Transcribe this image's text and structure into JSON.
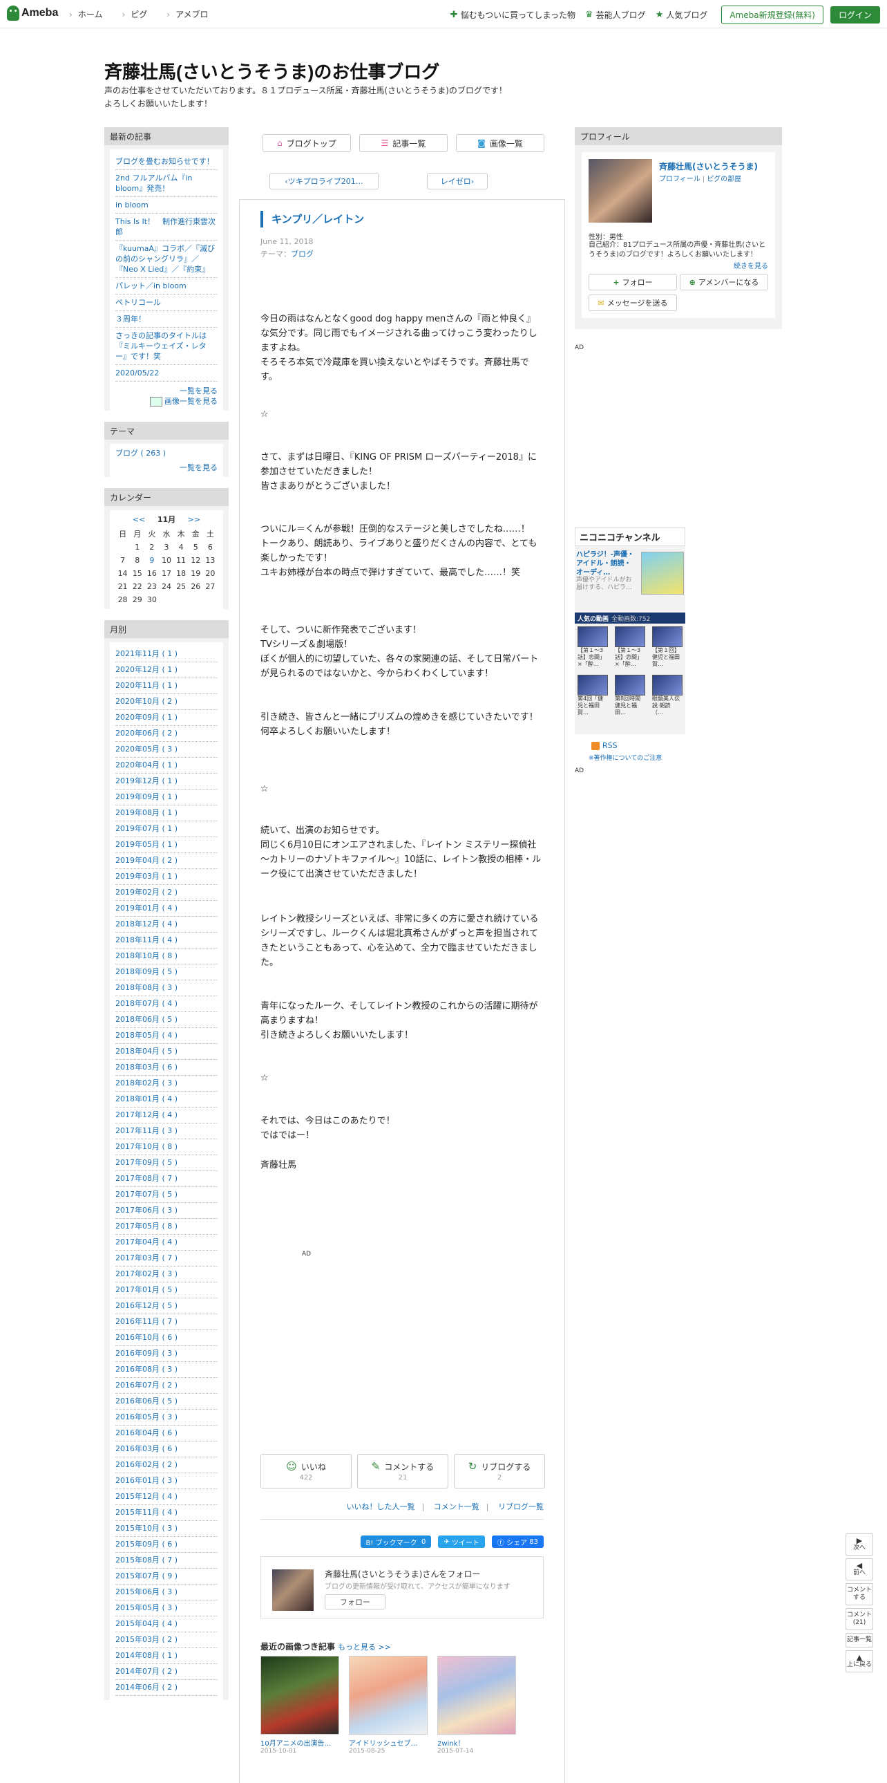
{
  "topbar": {
    "logo": "Ameba",
    "nav": [
      "ホーム",
      "ピグ",
      "アメブロ"
    ],
    "right_links": [
      {
        "icon": "green-star-icon",
        "label": "悩むもついに買ってしまった物"
      },
      {
        "icon": "crown-icon",
        "label": "芸能人ブログ"
      },
      {
        "icon": "star-icon",
        "label": "人気ブログ"
      }
    ],
    "register": "Ameba新規登録(無料)",
    "login": "ログイン"
  },
  "header": {
    "title": "斉藤壮馬(さいとうそうま)のお仕事ブログ",
    "desc1": "声のお仕事をさせていただいております。８１プロデュース所属・斉藤壮馬(さいとうそうま)のブログです！",
    "desc2": "よろしくお願いいたします！"
  },
  "latest": {
    "heading": "最新の記事",
    "items": [
      "ブログを畳むお知らせです！",
      "2nd フルアルバム『in bloom』発売！",
      "in bloom",
      "This Is It！　制作進行東雲次郎",
      "『kuumaA』コラボ／『滅びの前のシャングリラ』／『Neo X Lied』／『約束』",
      "パレット／in bloom",
      "ペトリコール",
      "３周年！",
      "さっきの記事のタイトルは『ミルキーウェイズ・レター』です！笑",
      "2020/05/22"
    ],
    "more": "一覧を見る",
    "img_more": "画像一覧を見る"
  },
  "theme": {
    "heading": "テーマ",
    "item": "ブログ ( 263 )",
    "more": "一覧を見る"
  },
  "calendar": {
    "heading": "カレンダー",
    "prev": "<<",
    "month": "11月",
    "next": ">>",
    "weekdays": [
      "日",
      "月",
      "火",
      "水",
      "木",
      "金",
      "土"
    ],
    "days": [
      "",
      "1",
      "2",
      "3",
      "4",
      "5",
      "6",
      "7",
      "8",
      "9",
      "10",
      "11",
      "12",
      "13",
      "14",
      "15",
      "16",
      "17",
      "18",
      "19",
      "20",
      "21",
      "22",
      "23",
      "24",
      "25",
      "26",
      "27",
      "28",
      "29",
      "30",
      "",
      "",
      "",
      ""
    ],
    "highlight": "9"
  },
  "monthly": {
    "heading": "月別",
    "items": [
      "2021年11月 ( 1 )",
      "2020年12月 ( 1 )",
      "2020年11月 ( 1 )",
      "2020年10月 ( 2 )",
      "2020年09月 ( 1 )",
      "2020年06月 ( 2 )",
      "2020年05月 ( 3 )",
      "2020年04月 ( 1 )",
      "2019年12月 ( 1 )",
      "2019年09月 ( 1 )",
      "2019年08月 ( 1 )",
      "2019年07月 ( 1 )",
      "2019年05月 ( 1 )",
      "2019年04月 ( 2 )",
      "2019年03月 ( 1 )",
      "2019年02月 ( 2 )",
      "2019年01月 ( 4 )",
      "2018年12月 ( 4 )",
      "2018年11月 ( 4 )",
      "2018年10月 ( 8 )",
      "2018年09月 ( 5 )",
      "2018年08月 ( 3 )",
      "2018年07月 ( 4 )",
      "2018年06月 ( 5 )",
      "2018年05月 ( 4 )",
      "2018年04月 ( 5 )",
      "2018年03月 ( 6 )",
      "2018年02月 ( 3 )",
      "2018年01月 ( 4 )",
      "2017年12月 ( 4 )",
      "2017年11月 ( 3 )",
      "2017年10月 ( 8 )",
      "2017年09月 ( 5 )",
      "2017年08月 ( 7 )",
      "2017年07月 ( 5 )",
      "2017年06月 ( 3 )",
      "2017年05月 ( 8 )",
      "2017年04月 ( 4 )",
      "2017年03月 ( 7 )",
      "2017年02月 ( 3 )",
      "2017年01月 ( 5 )",
      "2016年12月 ( 5 )",
      "2016年11月 ( 7 )",
      "2016年10月 ( 6 )",
      "2016年09月 ( 3 )",
      "2016年08月 ( 3 )",
      "2016年07月 ( 2 )",
      "2016年06月 ( 5 )",
      "2016年05月 ( 3 )",
      "2016年04月 ( 6 )",
      "2016年03月 ( 6 )",
      "2016年02月 ( 2 )",
      "2016年01月 ( 3 )",
      "2015年12月 ( 4 )",
      "2015年11月 ( 4 )",
      "2015年10月 ( 3 )",
      "2015年09月 ( 6 )",
      "2015年08月 ( 7 )",
      "2015年07月 ( 9 )",
      "2015年06月 ( 3 )",
      "2015年05月 ( 3 )",
      "2015年04月 ( 4 )",
      "2015年03月 ( 2 )",
      "2014年08月 ( 1 )",
      "2014年07月 ( 2 )",
      "2014年06月 ( 2 )"
    ]
  },
  "main_nav": {
    "top": "ブログトップ",
    "list": "記事一覧",
    "images": "画像一覧"
  },
  "pager": {
    "prev": "ツキプロライブ201…",
    "next": "レイゼロ"
  },
  "article": {
    "title": "キンプリ／レイトン",
    "date": "June 11, 2018",
    "theme_label": "テーマ：",
    "theme": "ブログ",
    "paragraphs": [
      "今日の雨はなんとなくgood dog happy menさんの『雨と仲良く』な気分です。同じ雨でもイメージされる曲ってけっこう変わったりしますよね。\nそろそろ本気で冷蔵庫を買い換えないとやばそうです。斉藤壮馬です。",
      "☆",
      "さて、まずは日曜日、『KING OF PRISM ローズパーティー2018』に参加させていただきました！\n皆さまありがとうございました！",
      "ついにル＝くんが参戦！圧倒的なステージと美しさでしたね……！\nトークあり、朗読あり、ライブありと盛りだくさんの内容で、とても楽しかったです！\nユキお姉様が台本の時点で弾けすぎていて、最高でした……！笑",
      "そして、ついに新作発表でございます！\nTVシリーズ＆劇場版！\nぼくが個人的に切望していた、各々の家関連の話、そして日常パートが見られるのではないかと、今からわくわくしています！",
      "引き続き、皆さんと一緒にプリズムの煌めきを感じていきたいです！\n何卒よろしくお願いいたします！",
      "☆",
      "続いて、出演のお知らせです。\n同じく6月10日にオンエアされました、『レイトン ミステリー探偵社 〜カトリーのナゾトキファイル〜』10話に、レイトン教授の相棒・ルーク役にて出演させていただきました！",
      "レイトン教授シリーズといえば、非常に多くの方に愛され続けているシリーズですし、ルークくんは堀北真希さんがずっと声を担当されてきたということもあって、心を込めて、全力で臨ませていただきました。",
      "青年になったルーク、そしてレイトン教授のこれからの活躍に期待が高まりますね！\n引き続きよろしくお願いいたします！",
      "☆",
      "それでは、今日はこのあたりで！\nではではー！",
      "斉藤壮馬"
    ],
    "ad": "AD"
  },
  "reactions": {
    "like": "いいね",
    "like_count": "422",
    "comment": "コメントする",
    "comment_count": "21",
    "reblog": "リブログする",
    "reblog_count": "2",
    "links": [
      "いいね！した人一覧",
      "コメント一覧",
      "リブログ一覧"
    ]
  },
  "share": {
    "hatena": "B! ブックマーク",
    "hatena_count": "0",
    "tweet": "ツイート",
    "facebook": "シェア",
    "facebook_count": "83"
  },
  "follow_box": {
    "title": "斉藤壮馬(さいとうそうま)さんをフォロー",
    "sub": "ブログの更新情報が受け取れて、アクセスが簡単になります",
    "button": "フォロー"
  },
  "image_articles": {
    "heading": "最近の画像つき記事",
    "more": "もっと見る >>",
    "items": [
      {
        "title": "10月アニメの出演告…",
        "date": "2015-10-01"
      },
      {
        "title": "アイドリッシュセブ…",
        "date": "2015-08-25"
      },
      {
        "title": "2wink！",
        "date": "2015-07-14"
      }
    ]
  },
  "profile": {
    "heading": "プロフィール",
    "name": "斉藤壮馬(さいとうそうま)",
    "link1": "プロフィール",
    "link2": "ピグの部屋",
    "sex": "性別：男性",
    "intro": "自己紹介：81プロデュース所属の声優・斉藤壮馬(さいとうそうま)のブログです！よろしくお願いいたします！",
    "more": "続きを見る",
    "follow": "フォロー",
    "member": "アメンバーになる",
    "message": "メッセージを送る"
  },
  "right_ad1": "AD",
  "niconico": {
    "logo": "ニコニコチャンネル",
    "title": "ハピラジ！-声優・アイドル・朗読・オーディ…",
    "sub": "声優やアイドルがお届けする、ハピラ…",
    "bar": "人気の動画",
    "bar_count": "全動画数:752",
    "videos": [
      "【第１〜3話】恋間」×「酔…",
      "【第１〜3話】恋間」×「酔…",
      "【第１回】健児と福田賀…",
      "第4回「健児と福田賀…",
      "第8回時間健児と福田…",
      "眼鏡美人伝説 朗読（…"
    ]
  },
  "rss": "RSS",
  "rss_note": "※著作権についてのご注意",
  "right_ad2": "AD",
  "floatnav": {
    "next": "次へ",
    "prev": "前へ",
    "comment": "コメントする",
    "comment_count": "コメント(21)",
    "list": "記事一覧",
    "top": "上に戻る"
  }
}
